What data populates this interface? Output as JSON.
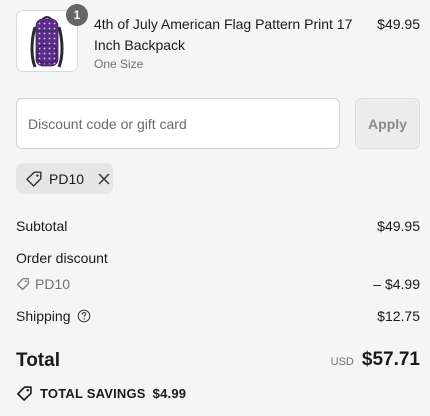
{
  "product": {
    "quantity": "1",
    "title": "4th of July American Flag Pattern Print 17 Inch Backpack",
    "variant": "One Size",
    "price": "$49.95",
    "image_icon": "backpack-image"
  },
  "discount": {
    "placeholder": "Discount code or gift card",
    "value": "",
    "apply_label": "Apply",
    "applied_code": "PD10"
  },
  "summary": {
    "subtotal_label": "Subtotal",
    "subtotal_value": "$49.95",
    "order_discount_label": "Order discount",
    "discount_code": "PD10",
    "discount_value": "– $4.99",
    "shipping_label": "Shipping",
    "shipping_value": "$12.75",
    "total_label": "Total",
    "total_currency": "USD",
    "total_value": "$57.71",
    "savings_label": "TOTAL SAVINGS",
    "savings_value": "$4.99"
  },
  "colors": {
    "background": "#f5f5f5",
    "text": "#1a1a1a",
    "muted_text": "#707070",
    "badge": "#666666",
    "tag_background": "#e6e6e6",
    "backpack_purple": "#5a2d8a"
  }
}
